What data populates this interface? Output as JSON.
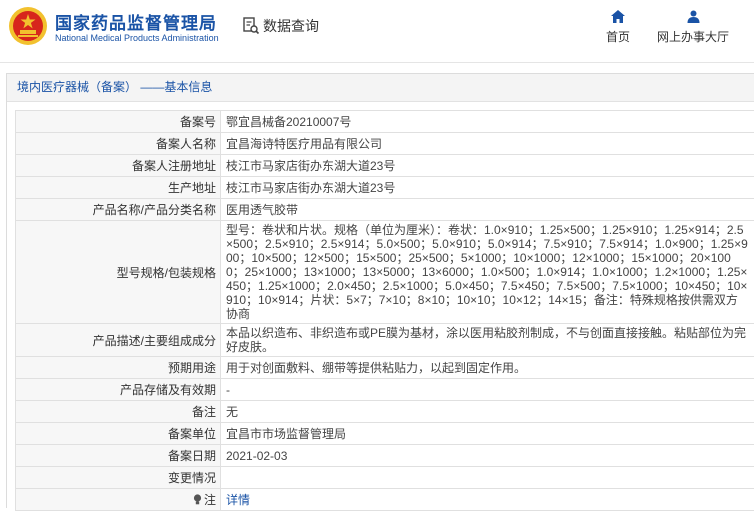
{
  "header": {
    "title_cn": "国家药品监督管理局",
    "title_en": "National Medical Products Administration",
    "query_label": "数据查询",
    "nav": [
      {
        "label": "首页",
        "icon": "home-icon"
      },
      {
        "label": "网上办事大厅",
        "icon": "user-icon"
      }
    ]
  },
  "breadcrumb": "境内医疗器械（备案） ——基本信息",
  "colors": {
    "brand": "#1a53a6",
    "emblem_red": "#d7261c",
    "emblem_gold": "#f2c12e"
  },
  "rows": [
    {
      "label": "备案号",
      "value": "鄂宜昌械备20210007号"
    },
    {
      "label": "备案人名称",
      "value": "宜昌海诗特医疗用品有限公司"
    },
    {
      "label": "备案人注册地址",
      "value": "枝江市马家店街办东湖大道23号"
    },
    {
      "label": "生产地址",
      "value": "枝江市马家店街办东湖大道23号"
    },
    {
      "label": "产品名称/产品分类名称",
      "value": "医用透气胶带"
    },
    {
      "label": "型号规格/包装规格",
      "value": "型号：卷状和片状。规格（单位为厘米）：卷状：1.0×910；1.25×500；1.25×910；1.25×914；2.5×500；2.5×910；2.5×914；5.0×500；5.0×910；5.0×914；7.5×910；7.5×914；1.0×900；1.25×900；10×500；12×500；15×500；25×500；5×1000；10×1000；12×1000；15×1000；20×1000；25×1000；13×1000；13×5000；13×6000；1.0×500；1.0×914；1.0×1000；1.2×1000；1.25×450；1.25×1000；2.0×450；2.5×1000；5.0×450；7.5×450；7.5×500；7.5×1000；10×450；10×910；10×914；片状：5×7；7×10；8×10；10×10；10×12；14×15；备注：特殊规格按供需双方协商"
    },
    {
      "label": "产品描述/主要组成成分",
      "value": "本品以织造布、非织造布或PE膜为基材，涂以医用粘胶剂制成，不与创面直接接触。粘贴部位为完好皮肤。"
    },
    {
      "label": "预期用途",
      "value": "用于对创面敷料、绷带等提供粘贴力，以起到固定作用。"
    },
    {
      "label": "产品存储及有效期",
      "value": "-"
    },
    {
      "label": "备注",
      "value": "无"
    },
    {
      "label": "备案单位",
      "value": "宜昌市市场监督管理局"
    },
    {
      "label": "备案日期",
      "value": "2021-02-03"
    },
    {
      "label": "变更情况",
      "value": ""
    }
  ],
  "note_row": {
    "label": "注",
    "link": "详情",
    "icon": "lightbulb-icon"
  }
}
